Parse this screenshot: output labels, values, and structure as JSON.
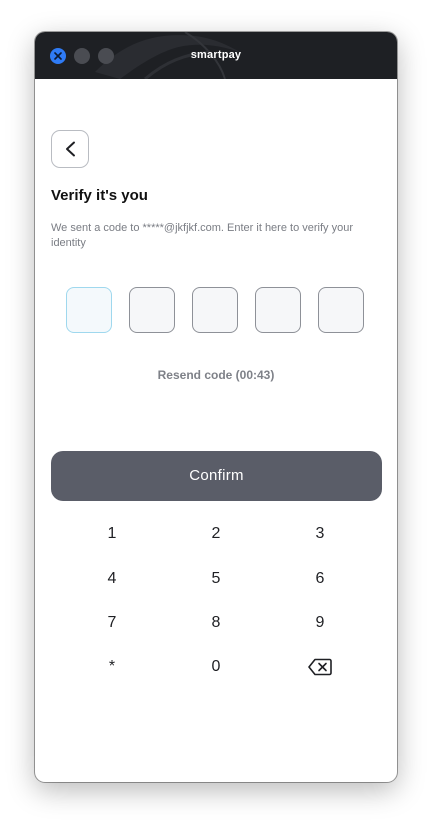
{
  "window": {
    "title": "smartpay"
  },
  "header": {
    "back_icon": "chevron-left-icon"
  },
  "page": {
    "title": "Verify it's you",
    "subtitle": "We sent a code to *****@jkfjkf.com. Enter it here to verify your identity"
  },
  "code": {
    "digits": [
      "",
      "",
      "",
      "",
      ""
    ]
  },
  "resend": {
    "label": "Resend code (00:43)"
  },
  "confirm": {
    "label": "Confirm"
  },
  "keypad": {
    "keys": [
      "1",
      "2",
      "3",
      "4",
      "5",
      "6",
      "7",
      "8",
      "9",
      "*",
      "0"
    ],
    "delete_icon": "backspace-icon"
  },
  "colors": {
    "titlebar": "#1e2024",
    "close_button": "#2f7bf5",
    "confirm_button": "#5a5d68",
    "active_box_border": "#9fd8ee"
  }
}
